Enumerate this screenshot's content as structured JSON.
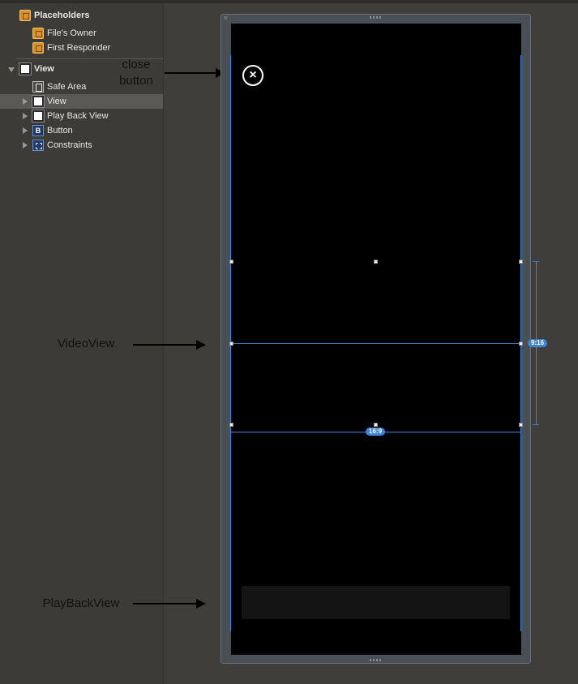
{
  "outline": {
    "placeholders": "Placeholders",
    "files_owner": "File's Owner",
    "first_responder": "First Responder",
    "view": "View",
    "children": [
      "Safe Area",
      "View",
      "Play Back View",
      "Button",
      "Constraints"
    ],
    "button_icon_letter": "B"
  },
  "annotations": {
    "close_button": "close\nbutton",
    "video_view": "VideoView",
    "playback_view": "PlayBackView"
  },
  "canvas": {
    "ratio_vertical": "9:16",
    "ratio_horizontal": "16:9",
    "close_glyph": "×",
    "accent_color": "#3d84d9"
  }
}
